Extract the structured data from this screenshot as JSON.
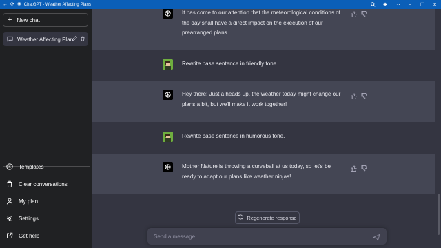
{
  "window": {
    "title": "ChatGPT - Weather Affecting Plans"
  },
  "sidebar": {
    "new_chat_label": "New chat",
    "conversations": [
      {
        "label": "Weather Affecting Plan"
      }
    ],
    "menu": [
      {
        "label": "Templates",
        "icon": "templates-icon"
      },
      {
        "label": "Clear conversations",
        "icon": "trash-icon"
      },
      {
        "label": "My plan",
        "icon": "user-icon"
      },
      {
        "label": "Settings",
        "icon": "gear-icon"
      },
      {
        "label": "Get help",
        "icon": "external-link-icon"
      }
    ]
  },
  "messages": [
    {
      "role": "assistant",
      "lines": [
        "It has come to our attention that the meteorological conditions of",
        "the day shall have a direct impact on the execution of our",
        "prearranged plans."
      ]
    },
    {
      "role": "user",
      "lines": [
        "Rewrite base sentence in friendly tone."
      ]
    },
    {
      "role": "assistant",
      "lines": [
        "Hey there! Just a heads up, the weather today might change our",
        "plans a bit, but we'll make it work together!"
      ]
    },
    {
      "role": "user",
      "lines": [
        "Rewrite base sentence in humorous tone."
      ]
    },
    {
      "role": "assistant",
      "lines": [
        "Mother Nature is throwing a curveball at us today, so let's be",
        "ready to adapt our plans like weather ninjas!"
      ]
    }
  ],
  "composer": {
    "regenerate_label": "Regenerate response",
    "placeholder": "Send a message..."
  },
  "colors": {
    "titlebar": "#0b5fb8",
    "sidebar": "#202123",
    "main": "#343541",
    "assistant_row": "#444654",
    "input": "#40414f"
  }
}
